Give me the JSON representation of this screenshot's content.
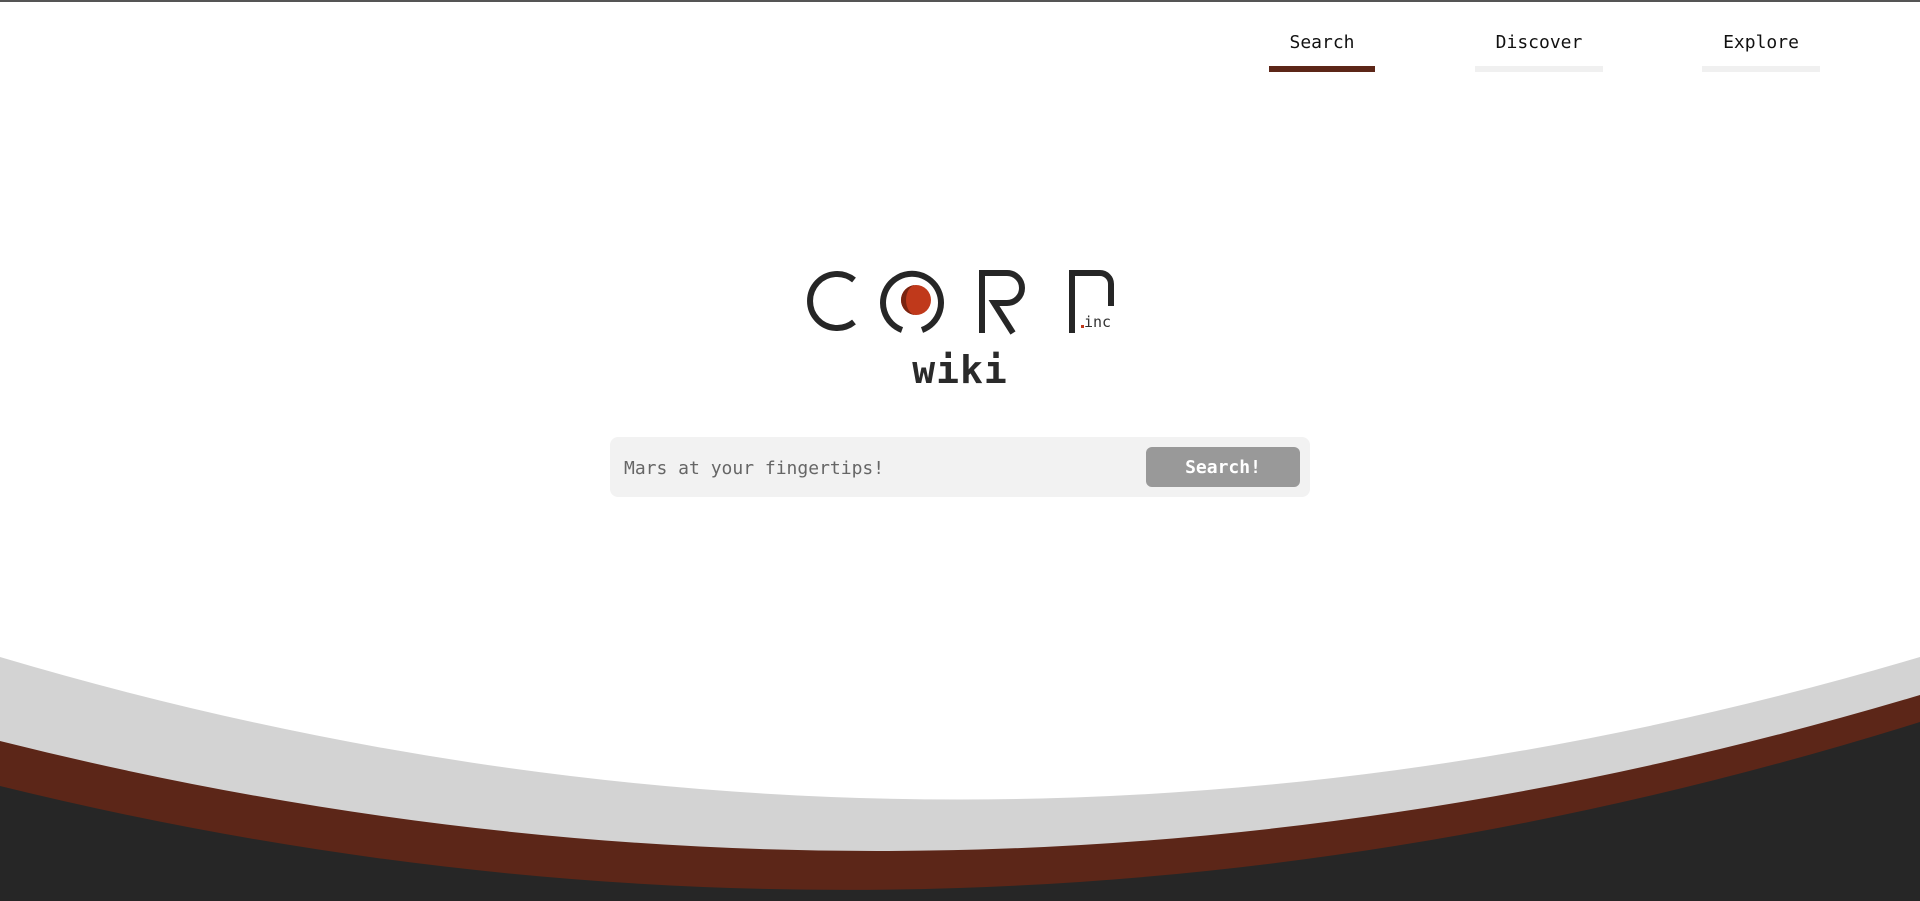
{
  "nav": {
    "tabs": [
      {
        "label": "Search",
        "active": true
      },
      {
        "label": "Discover",
        "active": false
      },
      {
        "label": "Explore",
        "active": false
      }
    ]
  },
  "logo": {
    "brand": "CORP",
    "suffix": ".inc",
    "product": "wiki"
  },
  "search": {
    "placeholder": "Mars at your fingertips!",
    "value": "",
    "button_label": "Search!"
  },
  "colors": {
    "accent": "#5c2618",
    "dark": "#262626",
    "light_gray": "#d3d3d3",
    "mars_red": "#c0391b",
    "button_gray": "#999999"
  }
}
